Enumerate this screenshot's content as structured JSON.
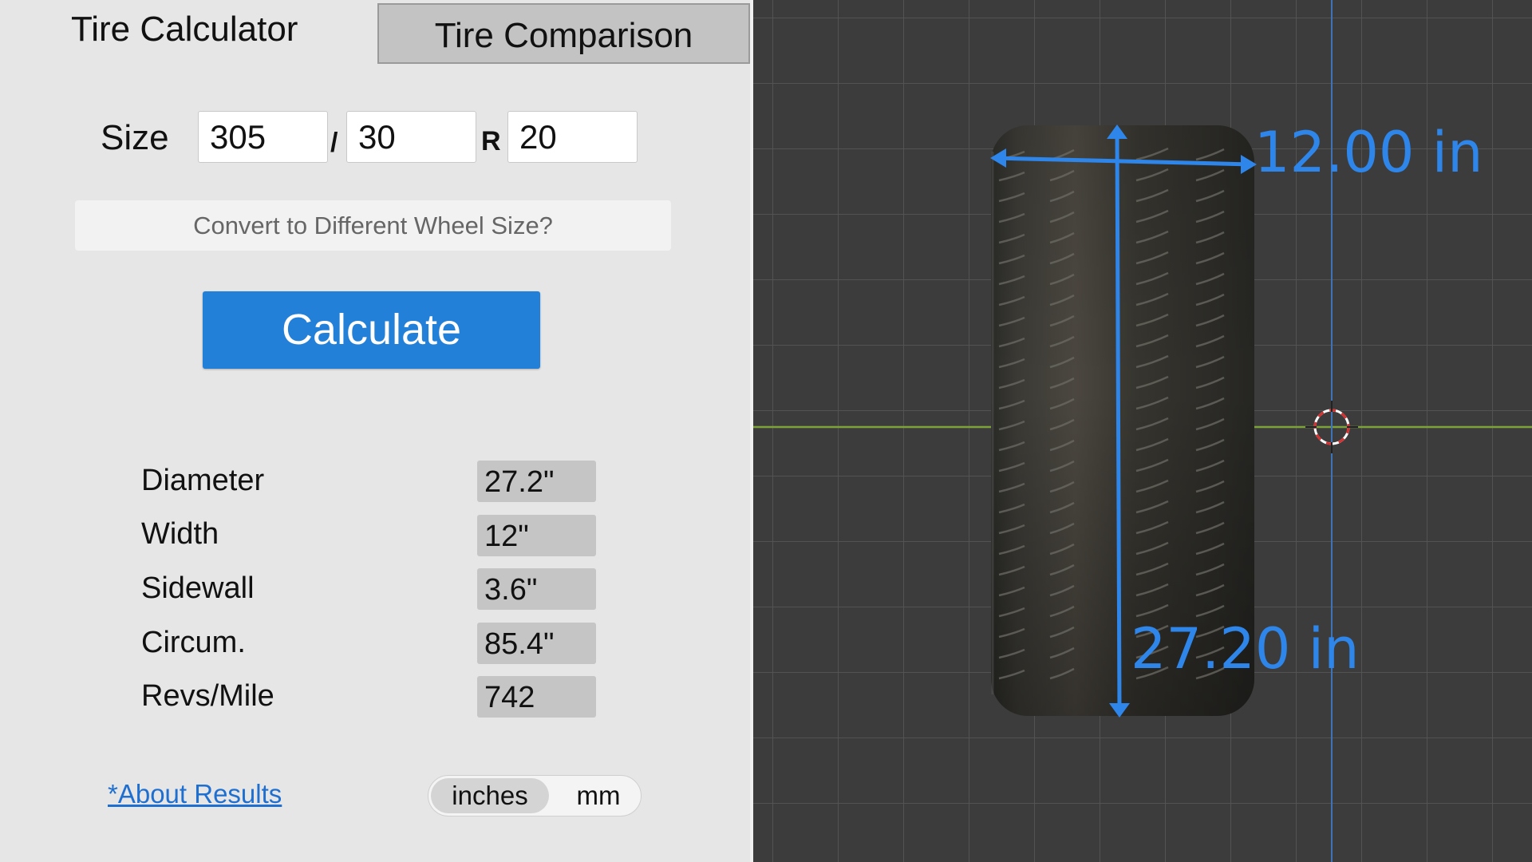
{
  "tabs": {
    "calculator": "Tire Calculator",
    "comparison": "Tire Comparison"
  },
  "size": {
    "label": "Size",
    "width": "305",
    "aspect": "30",
    "separator": "/",
    "construction": "R",
    "rim": "20"
  },
  "convert_label": "Convert to Different Wheel Size?",
  "calculate_label": "Calculate",
  "results": [
    {
      "label": "Diameter",
      "value": "27.2\""
    },
    {
      "label": "Width",
      "value": "12\""
    },
    {
      "label": "Sidewall",
      "value": "3.6\""
    },
    {
      "label": "Circum.",
      "value": "85.4\""
    },
    {
      "label": "Revs/Mile",
      "value": "742"
    }
  ],
  "about_link": "*About Results",
  "units": {
    "options": [
      "inches",
      "mm"
    ],
    "selected": "inches"
  },
  "viewport": {
    "width_annotation": "12.00 in",
    "diameter_annotation": "27.20 in",
    "annotation_color": "#2e86ea",
    "x_axis_color": "#7ea23a",
    "y_axis_color": "#3f73b8",
    "cursor_icon": "3d-cursor-icon"
  },
  "colors": {
    "accent": "#2380d8",
    "panel_bg": "#e6e6e6",
    "viewport_bg": "#3c3c3c"
  }
}
